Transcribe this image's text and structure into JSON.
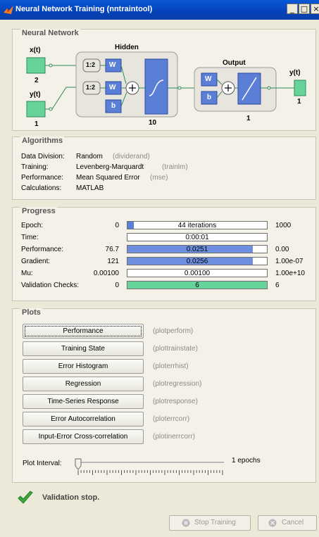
{
  "window": {
    "title": "Neural Network Training (nntraintool)",
    "controls": [
      "_",
      "□",
      "×"
    ]
  },
  "network": {
    "section_title": "Neural Network",
    "inputs": [
      {
        "name": "x(t)",
        "size": "2"
      },
      {
        "name": "y(t)",
        "size": "1"
      }
    ],
    "hidden": {
      "title": "Hidden",
      "size": "10",
      "delay_label": "1:2",
      "w_label": "W",
      "b_label": "b"
    },
    "output": {
      "title": "Output",
      "size": "1",
      "w_label": "W",
      "b_label": "b"
    },
    "out_signal": {
      "name": "y(t)",
      "size": "1"
    }
  },
  "algorithms": {
    "section_title": "Algorithms",
    "rows": [
      {
        "label": "Data Division:",
        "value": "Random",
        "fn": "(dividerand)"
      },
      {
        "label": "Training:",
        "value": "Levenberg-Marquardt",
        "fn": "(trainlm)"
      },
      {
        "label": "Performance:",
        "value": "Mean Squared Error",
        "fn": "(mse)"
      },
      {
        "label": "Calculations:",
        "value": "MATLAB",
        "fn": ""
      }
    ]
  },
  "progress": {
    "section_title": "Progress",
    "rows": [
      {
        "label": "Epoch:",
        "start": "0",
        "current": "44 iterations",
        "end": "1000",
        "fraction": 0.044,
        "color": "#5b7fd6"
      },
      {
        "label": "Time:",
        "start": "",
        "current": "0:00:01",
        "end": "",
        "fraction": 0,
        "color": "#5b7fd6"
      },
      {
        "label": "Performance:",
        "start": "76.7",
        "current": "0.0251",
        "end": "0.00",
        "fraction": 0.9,
        "color": "#6e8fe0"
      },
      {
        "label": "Gradient:",
        "start": "121",
        "current": "0.0256",
        "end": "1.00e-07",
        "fraction": 0.9,
        "color": "#6e8fe0"
      },
      {
        "label": "Mu:",
        "start": "0.00100",
        "current": "0.00100",
        "end": "1.00e+10",
        "fraction": 0,
        "color": "#6e8fe0"
      },
      {
        "label": "Validation Checks:",
        "start": "0",
        "current": "6",
        "end": "6",
        "fraction": 1,
        "color": "#66d49a"
      }
    ]
  },
  "plots": {
    "section_title": "Plots",
    "buttons": [
      {
        "label": "Performance",
        "fn": "(plotperform)"
      },
      {
        "label": "Training State",
        "fn": "(plottrainstate)"
      },
      {
        "label": "Error Histogram",
        "fn": "(ploterrhist)"
      },
      {
        "label": "Regression",
        "fn": "(plotregression)"
      },
      {
        "label": "Time-Series Response",
        "fn": "(plotresponse)"
      },
      {
        "label": "Error Autocorrelation",
        "fn": "(ploterrcorr)"
      },
      {
        "label": "Input-Error Cross-correlation",
        "fn": "(plotinerrcorr)"
      }
    ],
    "interval_label": "Plot Interval:",
    "interval_value": "1 epochs"
  },
  "status": {
    "text": "Validation stop.",
    "color": "#3aa83a"
  },
  "footer": {
    "stop_label": "Stop Training",
    "cancel_label": "Cancel"
  }
}
